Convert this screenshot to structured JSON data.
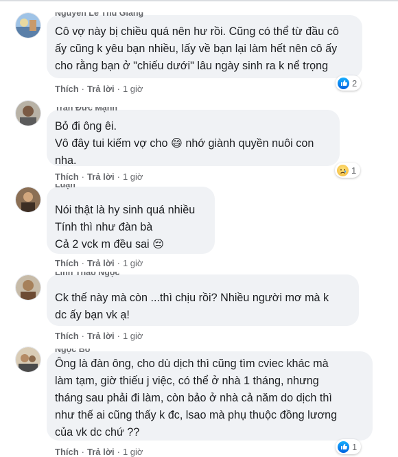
{
  "comments": [
    {
      "author": "Nguyễn Lê Thu Giang",
      "text": "Cô vợ này bị chiều quá nên hư rồi. Cũng có thể từ đầu cô\nấy cũng k yêu bạn nhiều, lấy về bạn lại làm hết nên cô ấy\ncho rằng bạn ở \"chiếu dưới\" lâu ngày sinh ra k nể trọng",
      "like_label": "Thích",
      "reply_label": "Trả lời",
      "time": "1 giờ",
      "reaction_icon": "like-icon",
      "reaction_count": "2"
    },
    {
      "author": "Trần Đức Mạnh",
      "text": "Bỏ đi ông êi.\nVô đây tui kiếm vợ cho 😄 nhớ giành quyền nuôi con\nnha.",
      "like_label": "Thích",
      "reply_label": "Trả lời",
      "time": "1 giờ",
      "reaction_icon": "sad-icon",
      "reaction_count": "1"
    },
    {
      "author": "Luận",
      "text": "Nói thật là hy sinh quá nhiều\nTính thì như đàn bà\nCả 2 vck m đều sai 😔",
      "like_label": "Thích",
      "reply_label": "Trả lời",
      "time": "1 giờ"
    },
    {
      "author": "Linh Thảo Ngọc",
      "text": "Ck thế này mà còn ...thì chịu rồi? Nhiều người mơ mà k\ndc ấy bạn vk ạ!",
      "like_label": "Thích",
      "reply_label": "Trả lời",
      "time": "1 giờ"
    },
    {
      "author": "Ngọc Bố",
      "text": "Ông là đàn ông, cho dù dịch thì cũng tìm cviec khác mà\nlàm tạm, giờ thiếu j việc, có thể ở nhà 1 tháng, nhưng\ntháng sau phải đi làm, còn bảo ở nhà cả năm do dịch thì\nnhư thế ai cũng thấy k đc, lsao mà phụ thuộc đồng lương\ncủa vk dc chứ ??",
      "like_label": "Thích",
      "reply_label": "Trả lời",
      "time": "1 giờ",
      "reaction_icon": "like-icon",
      "reaction_count": "1"
    }
  ]
}
